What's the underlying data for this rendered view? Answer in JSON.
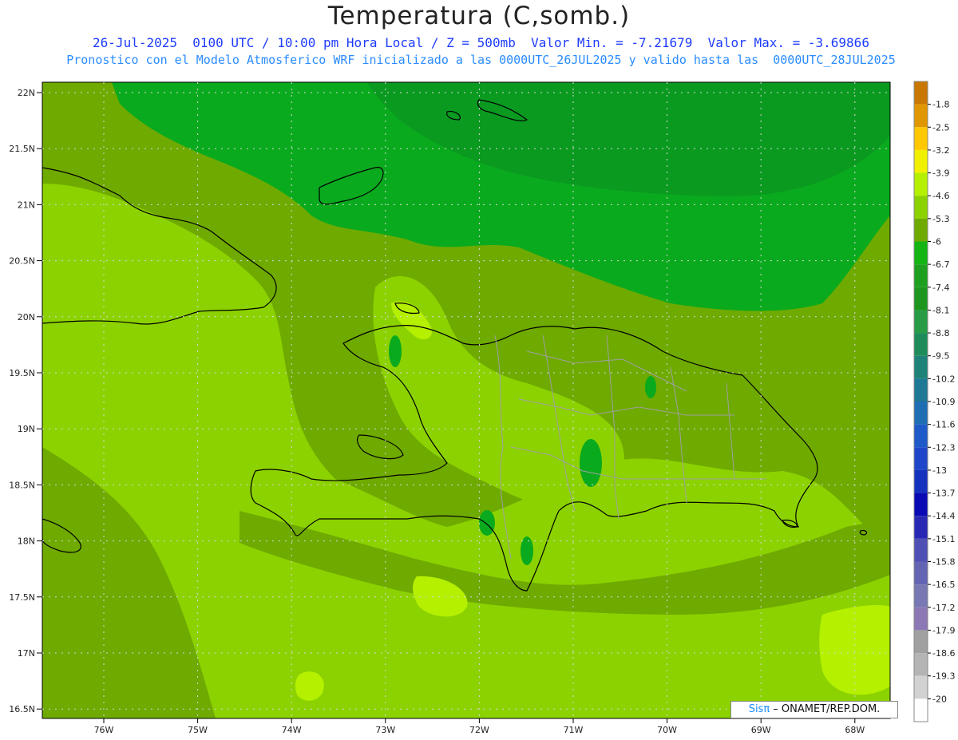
{
  "title": "Temperatura (C,somb.)",
  "subtitle_line1": "26-Jul-2025  0100 UTC / 10:00 pm Hora Local / Z = 500mb  Valor Min. = -7.21679  Valor Max. = -3.69866",
  "subtitle_line2": "Pronostico con el Modelo Atmosferico WRF inicializado a las 0000UTC_26JUL2025 y valido hasta las  0000UTC_28JUL2025",
  "lat_labels": [
    "22N",
    "21.5N",
    "21N",
    "20.5N",
    "20N",
    "19.5N",
    "19N",
    "18.5N",
    "18N",
    "17.5N",
    "17N",
    "16.5N"
  ],
  "lon_labels": [
    "76W",
    "75W",
    "74W",
    "73W",
    "72W",
    "71W",
    "70W",
    "69W",
    "68W"
  ],
  "colorbar": {
    "labels": [
      "-1.8",
      "-2.5",
      "-3.2",
      "-3.9",
      "-4.6",
      "-5.3",
      "-6",
      "-6.7",
      "-7.4",
      "-8.1",
      "-8.8",
      "-9.5",
      "-10.2",
      "-10.9",
      "-11.6",
      "-12.3",
      "-13",
      "-13.7",
      "-14.4",
      "-15.1",
      "-15.8",
      "-16.5",
      "-17.2",
      "-17.9",
      "-18.6",
      "-19.3",
      "-20"
    ],
    "colors": [
      "#c87800",
      "#e09600",
      "#ffc800",
      "#f0f000",
      "#b4f000",
      "#8cd200",
      "#6eaa00",
      "#14b414",
      "#1ea01e",
      "#1e961e",
      "#289b46",
      "#1e8c5a",
      "#1e8278",
      "#1e7896",
      "#1e6eb4",
      "#1e5ac8",
      "#1e46c8",
      "#1432be",
      "#0a0ab4",
      "#2828b4",
      "#5050b4",
      "#6464b4",
      "#7878b4",
      "#8c78b4",
      "#a0a0a0",
      "#b4b4b4",
      "#d2d2d2",
      "#ffffff"
    ]
  },
  "fills": {
    "dark_green": "#0aaa1e",
    "mid_green": "#6eaa00",
    "light_green": "#8cd200",
    "yellow_green": "#b4f000"
  },
  "credit": {
    "sis": "Sisπ",
    "rest": " – ONAMET/REP.DOM."
  }
}
